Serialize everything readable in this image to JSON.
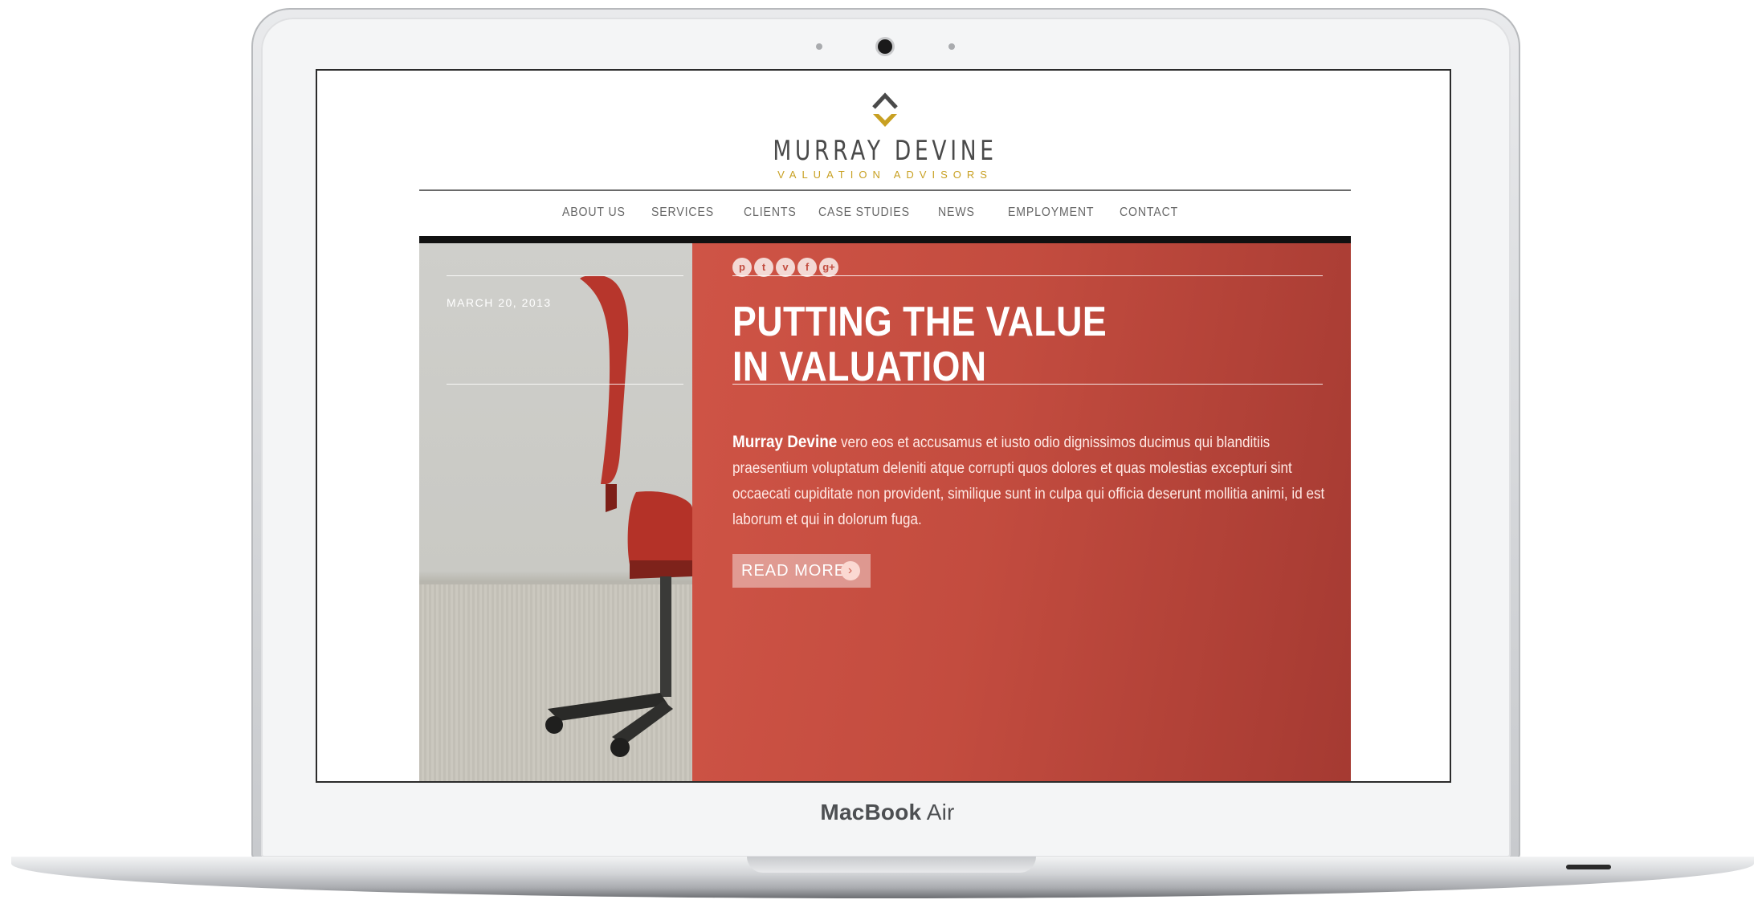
{
  "device": {
    "label_bold": "MacBook",
    "label_rest": " Air"
  },
  "site": {
    "logo_name": "MURRAY DEVINE",
    "logo_tagline": "VALUATION ADVISORS",
    "accent_color": "#c8a022",
    "hero_color": "#c34c3f"
  },
  "nav": {
    "items": [
      {
        "label": "ABOUT US"
      },
      {
        "label": "SERVICES"
      },
      {
        "label": "CLIENTS"
      },
      {
        "label": "CASE STUDIES"
      },
      {
        "label": "NEWS"
      },
      {
        "label": "EMPLOYMENT"
      },
      {
        "label": "CONTACT"
      }
    ]
  },
  "hero": {
    "date": "MARCH 20, 2013",
    "social_icons": [
      "pinterest-icon",
      "twitter-icon",
      "vimeo-icon",
      "facebook-icon",
      "google-plus-icon"
    ],
    "social_glyphs": [
      "p",
      "t",
      "v",
      "f",
      "g+"
    ],
    "headline_part1": "PUTTING THE ",
    "headline_bold": "VALUE",
    "headline_line2": "IN VALUATION",
    "body_bold": "Murray Devine",
    "body_text": " vero eos et accusamus et iusto odio dignissimos ducimus qui blanditiis praesentium voluptatum deleniti atque corrupti quos dolores et quas molestias excepturi sint occaecati cupiditate non provident, similique sunt in culpa qui officia deserunt mollitia animi, id est laborum et qui in dolorum fuga.",
    "read_more": "READ MORE",
    "read_more_arrow": "›"
  }
}
